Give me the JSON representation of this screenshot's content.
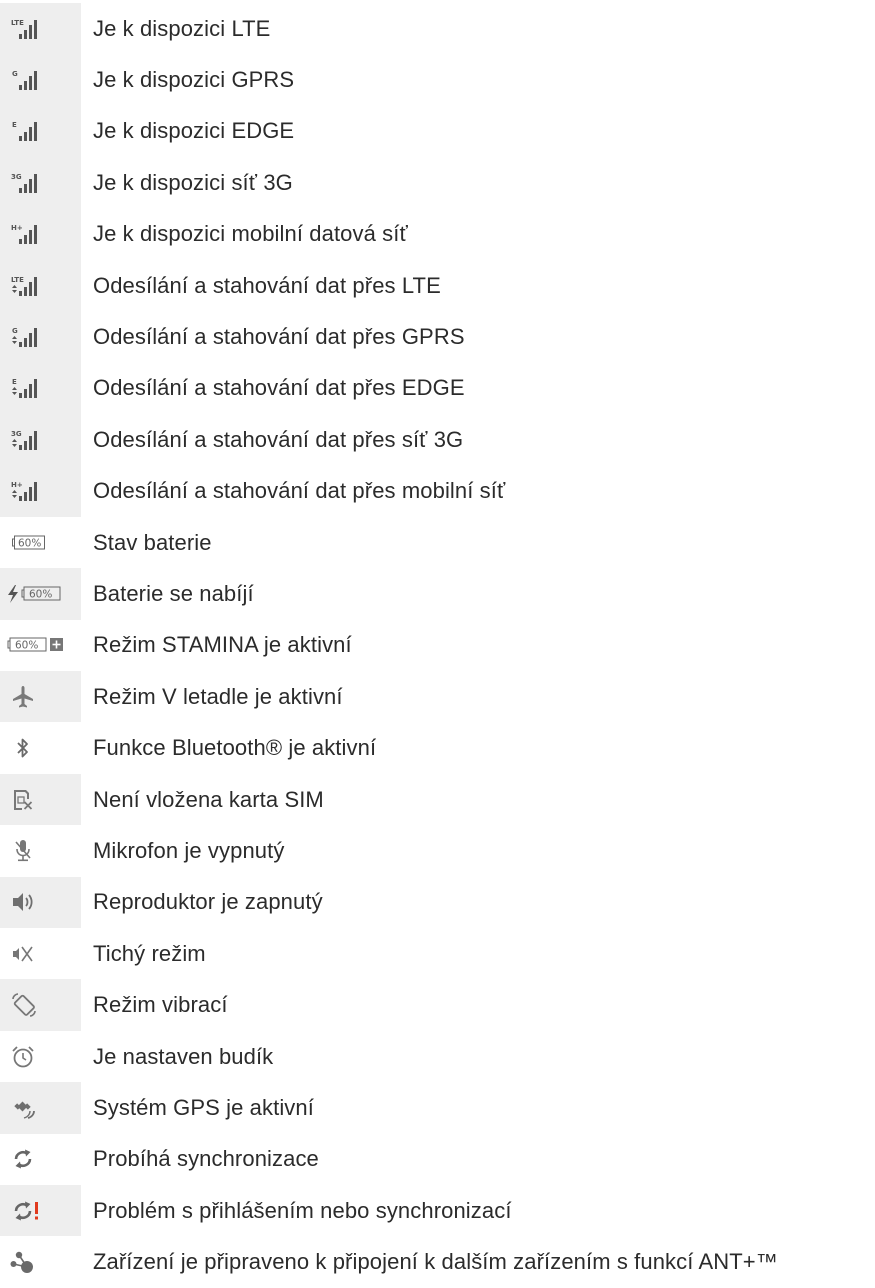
{
  "rows": [
    {
      "icon": "lte-signal-icon",
      "tag": "LTE",
      "arrows": false,
      "label": "Je k dispozici LTE"
    },
    {
      "icon": "gprs-signal-icon",
      "tag": "G",
      "arrows": false,
      "label": "Je k dispozici GPRS"
    },
    {
      "icon": "edge-signal-icon",
      "tag": "E",
      "arrows": false,
      "label": "Je k dispozici EDGE"
    },
    {
      "icon": "3g-signal-icon",
      "tag": "3G",
      "arrows": false,
      "label": "Je k dispozici síť 3G"
    },
    {
      "icon": "hplus-signal-icon",
      "tag": "H+",
      "arrows": false,
      "label": "Je k dispozici mobilní datová síť"
    },
    {
      "icon": "lte-data-transfer-icon",
      "tag": "LTE",
      "arrows": true,
      "label": "Odesílání a stahování dat přes LTE"
    },
    {
      "icon": "gprs-data-transfer-icon",
      "tag": "G",
      "arrows": true,
      "label": "Odesílání a stahování dat přes GPRS"
    },
    {
      "icon": "edge-data-transfer-icon",
      "tag": "E",
      "arrows": true,
      "label": "Odesílání a stahování dat přes EDGE"
    },
    {
      "icon": "3g-data-transfer-icon",
      "tag": "3G",
      "arrows": true,
      "label": "Odesílání a stahování dat přes síť 3G"
    },
    {
      "icon": "hplus-data-transfer-icon",
      "tag": "H+",
      "arrows": true,
      "label": "Odesílání a stahování dat přes mobilní síť"
    },
    {
      "icon": "battery-icon",
      "battery_text": "60%",
      "label": "Stav baterie"
    },
    {
      "icon": "battery-charging-icon",
      "battery_text": "60%",
      "label": "Baterie se nabíjí"
    },
    {
      "icon": "battery-stamina-icon",
      "battery_text": "60%",
      "label": "Režim STAMINA je aktivní"
    },
    {
      "icon": "airplane-icon",
      "label": "Režim V letadle je aktivní"
    },
    {
      "icon": "bluetooth-icon",
      "label": "Funkce Bluetooth® je aktivní"
    },
    {
      "icon": "no-sim-icon",
      "label": "Není vložena karta SIM"
    },
    {
      "icon": "mic-muted-icon",
      "label": "Mikrofon je vypnutý"
    },
    {
      "icon": "speaker-icon",
      "label": "Reproduktor je zapnutý"
    },
    {
      "icon": "silent-mode-icon",
      "label": "Tichý režim"
    },
    {
      "icon": "vibrate-icon",
      "label": "Režim vibrací"
    },
    {
      "icon": "alarm-clock-icon",
      "label": "Je nastaven budík"
    },
    {
      "icon": "gps-icon",
      "label": "Systém GPS je aktivní"
    },
    {
      "icon": "sync-icon",
      "label": "Probíhá synchronizace"
    },
    {
      "icon": "sync-error-icon",
      "label": "Problém s přihlášením nebo synchronizací"
    },
    {
      "icon": "ant-plus-icon",
      "label": "Zařízení je připraveno k připojení k dalším zařízením s funkcí ANT+™"
    }
  ],
  "colors": {
    "shade": "#eeeeee",
    "icon": "#7a7a7a",
    "text": "#2b2b2b",
    "alert": "#e03a1e"
  }
}
